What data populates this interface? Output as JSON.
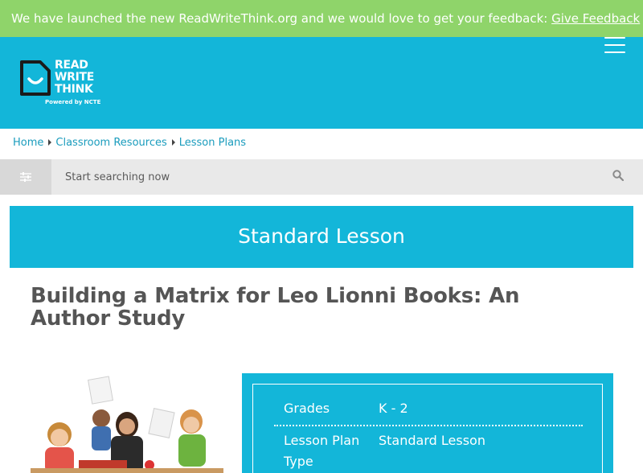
{
  "banner": {
    "text": "We have launched the new ReadWriteThink.org and we would love to get your feedback: ",
    "link": "Give Feedback"
  },
  "logo": {
    "line1": "READ",
    "line2": "WRITE",
    "line3": "THINK",
    "powered": "Powered by NCTE"
  },
  "breadcrumb": [
    "Home",
    "Classroom Resources",
    "Lesson Plans"
  ],
  "search": {
    "placeholder": "Start searching now"
  },
  "lesson_type": "Standard Lesson",
  "title": "Building a Matrix for Leo Lionni Books: An Author Study",
  "details": [
    {
      "label": "Grades",
      "value": "K - 2"
    },
    {
      "label": "Lesson Plan Type",
      "value": "Standard Lesson"
    }
  ],
  "colors": {
    "banner": "#8fd46a",
    "brand": "#13b6d9",
    "link": "#1a9cbd",
    "title": "#555555"
  }
}
